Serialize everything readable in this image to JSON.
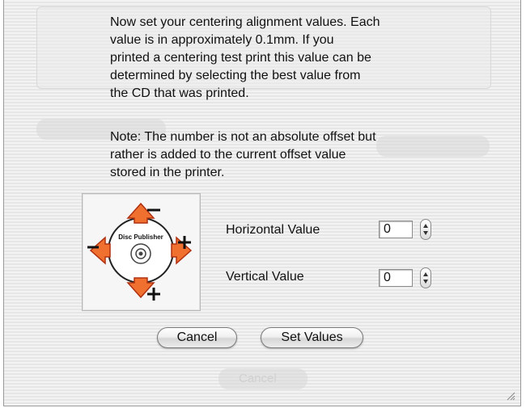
{
  "instructions": {
    "paragraph1": "Now set your centering alignment values.  Each\nvalue is in approximately 0.1mm.  If you\nprinted a centering test print this value can be\ndetermined by selecting the best value from\nthe CD that was printed.",
    "paragraph2": "Note:  The number is not an absolute offset but\nrather is added to the current offset value\nstored in the printer."
  },
  "image": {
    "disc_label": "Disc Publisher",
    "icon": "cd-alignment-arrows-icon"
  },
  "fields": {
    "horizontal": {
      "label": "Horizontal Value",
      "value": "0"
    },
    "vertical": {
      "label": "Vertical Value",
      "value": "0"
    }
  },
  "buttons": {
    "cancel": "Cancel",
    "set_values": "Set Values"
  },
  "background_dialog": {
    "cancel": "Cancel"
  },
  "colors": {
    "arrow_orange": "#f07030",
    "arrow_dark": "#c03818",
    "text": "#111111"
  }
}
